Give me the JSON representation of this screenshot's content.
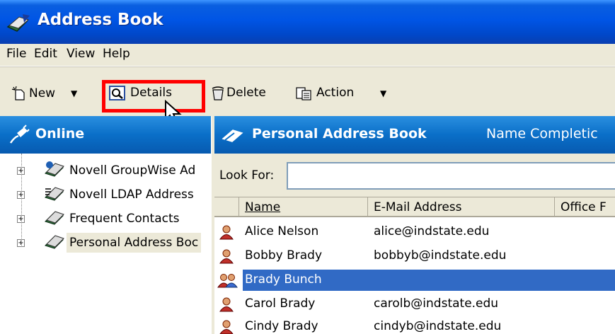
{
  "window": {
    "title": "Address Book",
    "title_icon": "address-book-icon"
  },
  "menu": [
    "File",
    "Edit",
    "View",
    "Help"
  ],
  "toolbar": {
    "new_label": "New",
    "details_label": "Details",
    "delete_label": "Delete",
    "action_label": "Action"
  },
  "left_pane": {
    "header": "Online",
    "items": [
      {
        "label": "Novell GroupWise Ad",
        "icon": "groupwise-book-icon"
      },
      {
        "label": "Novell LDAP Address",
        "icon": "ldap-book-icon"
      },
      {
        "label": "Frequent Contacts",
        "icon": "address-book-icon"
      },
      {
        "label": "Personal Address Boc",
        "icon": "address-book-icon"
      }
    ]
  },
  "right_pane": {
    "header": "Personal Address Book",
    "header_right": "Name Completic",
    "look_for_label": "Look For:",
    "look_for_value": "",
    "columns": [
      "Name",
      "E-Mail Address",
      "Office F"
    ],
    "rows": [
      {
        "name": "Alice Nelson",
        "email": "alice@indstate.edu",
        "icon": "contact-icon"
      },
      {
        "name": "Bobby Brady",
        "email": "bobbyb@indstate.edu",
        "icon": "contact-icon"
      },
      {
        "name": "Brady Bunch",
        "email": "",
        "icon": "group-icon"
      },
      {
        "name": "Carol Brady",
        "email": "carolb@indstate.edu",
        "icon": "contact-icon"
      },
      {
        "name": "Cindy Brady",
        "email": "cindyb@indstate.edu",
        "icon": "contact-icon"
      }
    ],
    "selected_index": 2
  },
  "colors": {
    "title_bar": "#0055e5",
    "pane_header": "#0a6fc8",
    "selection": "#316ac5",
    "highlight_box": "#ff0000"
  }
}
